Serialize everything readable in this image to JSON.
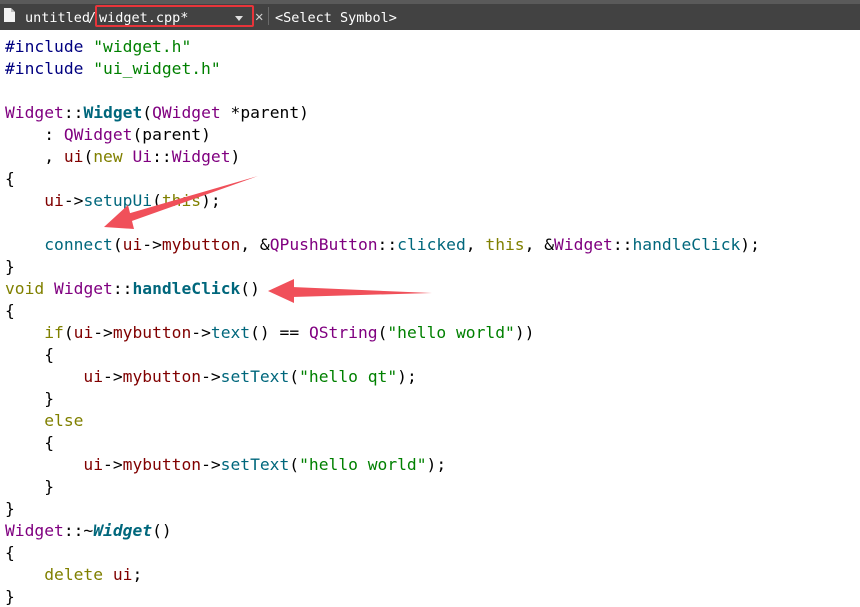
{
  "tabbar": {
    "project": "untitled",
    "separator": "/",
    "file_name": "widget.cpp*",
    "close_glyph": "✕",
    "symbol_placeholder": "<Select Symbol>",
    "file_icon": "file-icon",
    "highlight_color": "#e8343a"
  },
  "annotations": {
    "arrow_color": "#f0505a",
    "arrow_count": 2
  },
  "code": {
    "lines": [
      [
        {
          "t": "#include ",
          "c": "pp"
        },
        {
          "t": "\"widget.h\"",
          "c": "str"
        }
      ],
      [
        {
          "t": "#include ",
          "c": "pp"
        },
        {
          "t": "\"ui_widget.h\"",
          "c": "str"
        }
      ],
      [],
      [
        {
          "t": "Widget",
          "c": "cls"
        },
        {
          "t": "::",
          "c": "op"
        },
        {
          "t": "Widget",
          "c": "fnb"
        },
        {
          "t": "(",
          "c": "op"
        },
        {
          "t": "QWidget",
          "c": "cls"
        },
        {
          "t": " *",
          "c": "op"
        },
        {
          "t": "parent",
          "c": "plain"
        },
        {
          "t": ")",
          "c": "op"
        }
      ],
      [
        {
          "t": "    : ",
          "c": "op"
        },
        {
          "t": "QWidget",
          "c": "cls"
        },
        {
          "t": "(",
          "c": "op"
        },
        {
          "t": "parent",
          "c": "plain"
        },
        {
          "t": ")",
          "c": "op"
        }
      ],
      [
        {
          "t": "    , ",
          "c": "op"
        },
        {
          "t": "ui",
          "c": "mem"
        },
        {
          "t": "(",
          "c": "op"
        },
        {
          "t": "new",
          "c": "kw"
        },
        {
          "t": " ",
          "c": "op"
        },
        {
          "t": "Ui",
          "c": "cls"
        },
        {
          "t": "::",
          "c": "op"
        },
        {
          "t": "Widget",
          "c": "cls"
        },
        {
          "t": ")",
          "c": "op"
        }
      ],
      [
        {
          "t": "{",
          "c": "op"
        }
      ],
      [
        {
          "t": "    ",
          "c": "op"
        },
        {
          "t": "ui",
          "c": "mem"
        },
        {
          "t": "->",
          "c": "op"
        },
        {
          "t": "setupUi",
          "c": "fn"
        },
        {
          "t": "(",
          "c": "op"
        },
        {
          "t": "this",
          "c": "kw"
        },
        {
          "t": ");",
          "c": "op"
        }
      ],
      [],
      [
        {
          "t": "    ",
          "c": "op"
        },
        {
          "t": "connect",
          "c": "fn"
        },
        {
          "t": "(",
          "c": "op"
        },
        {
          "t": "ui",
          "c": "mem"
        },
        {
          "t": "->",
          "c": "op"
        },
        {
          "t": "mybutton",
          "c": "mem"
        },
        {
          "t": ", &",
          "c": "op"
        },
        {
          "t": "QPushButton",
          "c": "cls"
        },
        {
          "t": "::",
          "c": "op"
        },
        {
          "t": "clicked",
          "c": "fn"
        },
        {
          "t": ", ",
          "c": "op"
        },
        {
          "t": "this",
          "c": "kw"
        },
        {
          "t": ", &",
          "c": "op"
        },
        {
          "t": "Widget",
          "c": "cls"
        },
        {
          "t": "::",
          "c": "op"
        },
        {
          "t": "handleClick",
          "c": "fn"
        },
        {
          "t": ");",
          "c": "op"
        }
      ],
      [
        {
          "t": "}",
          "c": "op"
        }
      ],
      [
        {
          "t": "void",
          "c": "kw"
        },
        {
          "t": " ",
          "c": "op"
        },
        {
          "t": "Widget",
          "c": "cls"
        },
        {
          "t": "::",
          "c": "op"
        },
        {
          "t": "handleClick",
          "c": "fnb"
        },
        {
          "t": "()",
          "c": "op"
        }
      ],
      [
        {
          "t": "{",
          "c": "op"
        }
      ],
      [
        {
          "t": "    ",
          "c": "op"
        },
        {
          "t": "if",
          "c": "kw"
        },
        {
          "t": "(",
          "c": "op"
        },
        {
          "t": "ui",
          "c": "mem"
        },
        {
          "t": "->",
          "c": "op"
        },
        {
          "t": "mybutton",
          "c": "mem"
        },
        {
          "t": "->",
          "c": "op"
        },
        {
          "t": "text",
          "c": "fn"
        },
        {
          "t": "() == ",
          "c": "op"
        },
        {
          "t": "QString",
          "c": "cls"
        },
        {
          "t": "(",
          "c": "op"
        },
        {
          "t": "\"hello world\"",
          "c": "str"
        },
        {
          "t": "))",
          "c": "op"
        }
      ],
      [
        {
          "t": "    {",
          "c": "op"
        }
      ],
      [
        {
          "t": "        ",
          "c": "op"
        },
        {
          "t": "ui",
          "c": "mem"
        },
        {
          "t": "->",
          "c": "op"
        },
        {
          "t": "mybutton",
          "c": "mem"
        },
        {
          "t": "->",
          "c": "op"
        },
        {
          "t": "setText",
          "c": "fn"
        },
        {
          "t": "(",
          "c": "op"
        },
        {
          "t": "\"hello qt\"",
          "c": "str"
        },
        {
          "t": ");",
          "c": "op"
        }
      ],
      [
        {
          "t": "    }",
          "c": "op"
        }
      ],
      [
        {
          "t": "    ",
          "c": "op"
        },
        {
          "t": "else",
          "c": "kw"
        }
      ],
      [
        {
          "t": "    {",
          "c": "op"
        }
      ],
      [
        {
          "t": "        ",
          "c": "op"
        },
        {
          "t": "ui",
          "c": "mem"
        },
        {
          "t": "->",
          "c": "op"
        },
        {
          "t": "mybutton",
          "c": "mem"
        },
        {
          "t": "->",
          "c": "op"
        },
        {
          "t": "setText",
          "c": "fn"
        },
        {
          "t": "(",
          "c": "op"
        },
        {
          "t": "\"hello world\"",
          "c": "str"
        },
        {
          "t": ");",
          "c": "op"
        }
      ],
      [
        {
          "t": "    }",
          "c": "op"
        }
      ],
      [
        {
          "t": "}",
          "c": "op"
        }
      ],
      [
        {
          "t": "Widget",
          "c": "cls"
        },
        {
          "t": "::~",
          "c": "op"
        },
        {
          "t": "Widget",
          "c": "fni"
        },
        {
          "t": "()",
          "c": "op"
        }
      ],
      [
        {
          "t": "{",
          "c": "op"
        }
      ],
      [
        {
          "t": "    ",
          "c": "op"
        },
        {
          "t": "delete",
          "c": "kw"
        },
        {
          "t": " ",
          "c": "op"
        },
        {
          "t": "ui",
          "c": "mem"
        },
        {
          "t": ";",
          "c": "op"
        }
      ],
      [
        {
          "t": "}",
          "c": "op"
        }
      ]
    ]
  }
}
